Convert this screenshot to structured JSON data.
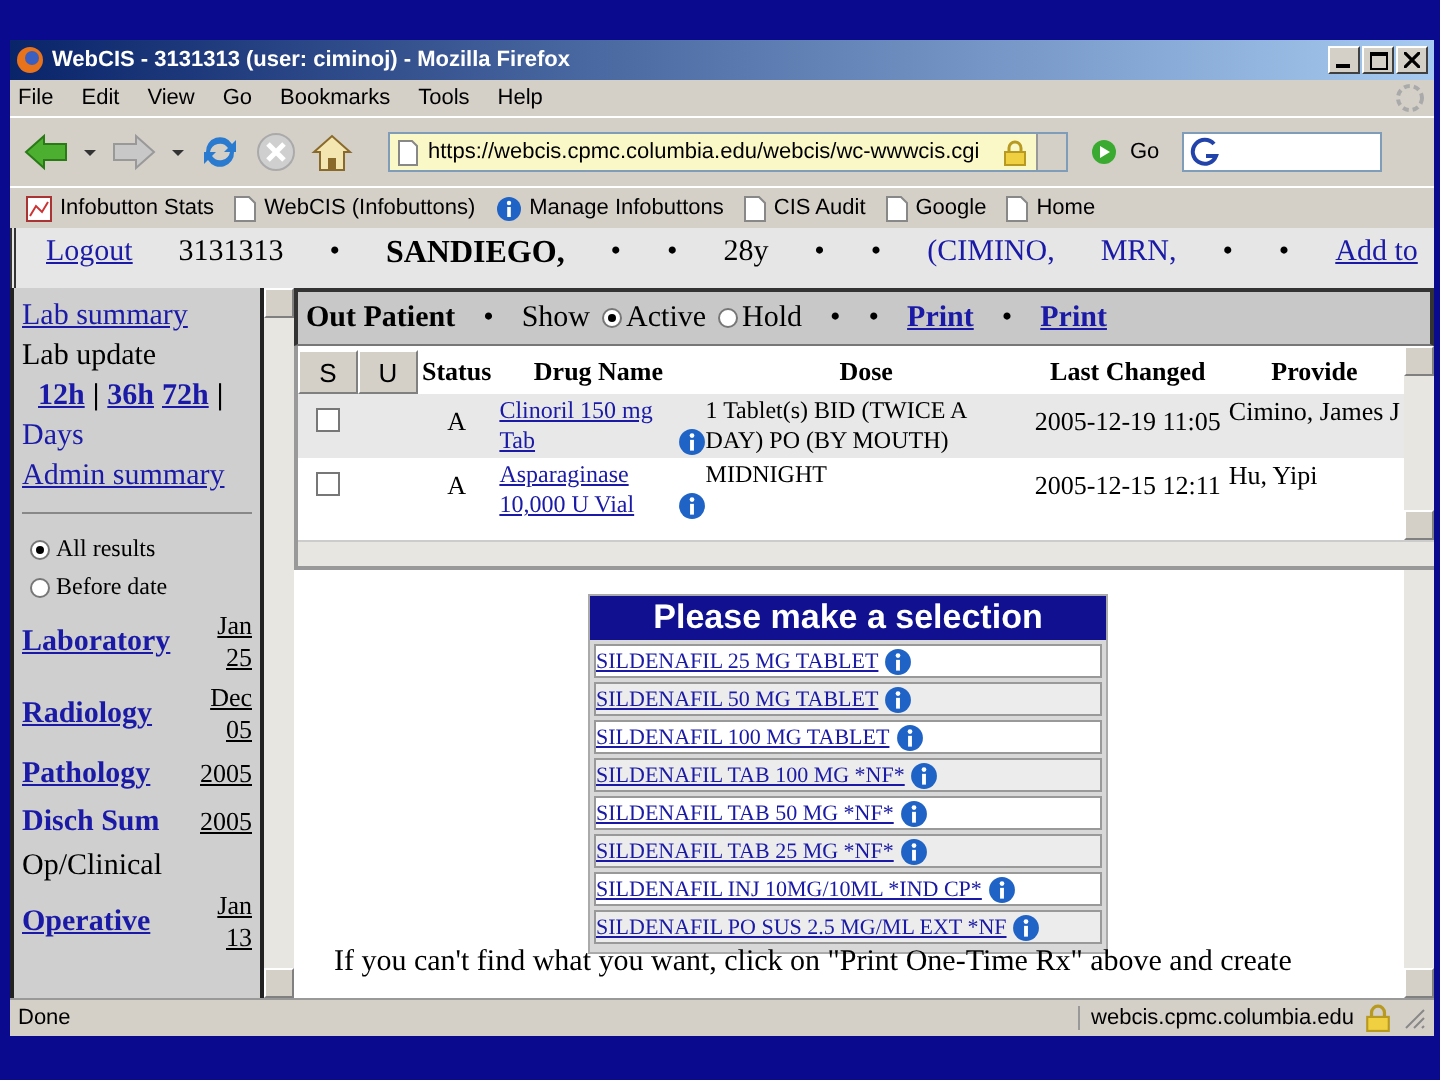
{
  "window": {
    "title": "WebCIS - 3131313 (user: ciminoj) - Mozilla Firefox"
  },
  "menu": [
    "File",
    "Edit",
    "View",
    "Go",
    "Bookmarks",
    "Tools",
    "Help"
  ],
  "address": {
    "value": "https://webcis.cpmc.columbia.edu/webcis/wc-wwwcis.cgi"
  },
  "go_label": "Go",
  "bookmarks": [
    {
      "label": "Infobutton Stats",
      "kind": "stats"
    },
    {
      "label": "WebCIS (Infobuttons)",
      "kind": "page"
    },
    {
      "label": "Manage Infobuttons",
      "kind": "info"
    },
    {
      "label": "CIS Audit",
      "kind": "page"
    },
    {
      "label": "Google",
      "kind": "page"
    },
    {
      "label": "Home",
      "kind": "page"
    }
  ],
  "patient_bar": [
    {
      "text": "Logout",
      "kind": "link"
    },
    {
      "text": "3131313",
      "kind": "text"
    },
    {
      "text": "•",
      "kind": "text"
    },
    {
      "text": "SANDIEGO,",
      "kind": "bold"
    },
    {
      "text": "•",
      "kind": "text"
    },
    {
      "text": "•",
      "kind": "text"
    },
    {
      "text": "28y",
      "kind": "text"
    },
    {
      "text": "•",
      "kind": "text"
    },
    {
      "text": "•",
      "kind": "text"
    },
    {
      "text": "(CIMINO,",
      "kind": "blue"
    },
    {
      "text": "MRN,",
      "kind": "blue"
    },
    {
      "text": "•",
      "kind": "text"
    },
    {
      "text": "•",
      "kind": "text"
    },
    {
      "text": "Add to",
      "kind": "link"
    }
  ],
  "sidebar": {
    "items": [
      {
        "kind": "link",
        "text": "Lab summary"
      },
      {
        "kind": "text",
        "text": "Lab update"
      },
      {
        "kind": "links",
        "parts": [
          {
            "text": "12h",
            "kind": "link"
          },
          {
            "text": "|",
            "kind": "text"
          },
          {
            "text": "36h",
            "kind": "link"
          },
          {
            "text": "72h",
            "kind": "link"
          },
          {
            "text": "|",
            "kind": "text"
          }
        ]
      },
      {
        "kind": "blue",
        "text": "Days"
      },
      {
        "kind": "link",
        "text": "Admin summary"
      },
      {
        "kind": "rule"
      },
      {
        "kind": "radio",
        "text": "All results",
        "selected": true
      },
      {
        "kind": "radio",
        "text": "Before date",
        "selected": false
      },
      {
        "kind": "dated",
        "text": "Laboratory",
        "date": "Jan 25",
        "link": true
      },
      {
        "kind": "dated",
        "text": "Radiology",
        "date": "Dec 05",
        "link": true
      },
      {
        "kind": "dated",
        "text": "Pathology",
        "date": "2005",
        "link": true
      },
      {
        "kind": "dated",
        "text": "Disch Sum",
        "date": "2005",
        "link": false
      },
      {
        "kind": "text",
        "text": "Op/Clinical"
      },
      {
        "kind": "dated",
        "text": "Operative",
        "date": "Jan 13",
        "link": true
      }
    ]
  },
  "order_toolbar": {
    "title": "Out Patient",
    "show_label": "Show",
    "bullet": "•",
    "filters": [
      {
        "label": "Active",
        "selected": true
      },
      {
        "label": "Hold",
        "selected": false
      }
    ],
    "print_links": [
      "Print",
      "Print"
    ]
  },
  "table": {
    "columns": [
      "S",
      "U",
      "Status",
      "Drug Name",
      "Dose",
      "Last Changed",
      "Provide"
    ],
    "rows": [
      {
        "checked": false,
        "status": "A",
        "drug": "Clinoril 150 mg Tab",
        "dose": "1 Tablet(s) BID (TWICE A DAY) PO (BY MOUTH)",
        "changed": "2005-12-19 11:05",
        "provider": "Cimino, James J"
      },
      {
        "checked": false,
        "status": "A",
        "drug": "Asparaginase 10,000 U Vial",
        "dose": "MIDNIGHT",
        "changed": "2005-12-15 12:11",
        "provider": "Hu, Yipi"
      }
    ]
  },
  "selection": {
    "title": "Please make a selection",
    "options": [
      "SILDENAFIL 25 MG TABLET",
      "SILDENAFIL 50 MG TABLET",
      "SILDENAFIL 100 MG TABLET",
      "SILDENAFIL TAB 100 MG *NF*",
      "SILDENAFIL TAB 50 MG *NF*",
      "SILDENAFIL TAB 25 MG *NF*",
      "SILDENAFIL INJ 10MG/10ML *IND CP*",
      "SILDENAFIL PO SUS 2.5 MG/ML EXT *NF"
    ]
  },
  "note": "If you can't find what you want, click on \"Print One-Time Rx\" above and create",
  "status_bar": {
    "text": "Done",
    "host": "webcis.cpmc.columbia.edu"
  }
}
